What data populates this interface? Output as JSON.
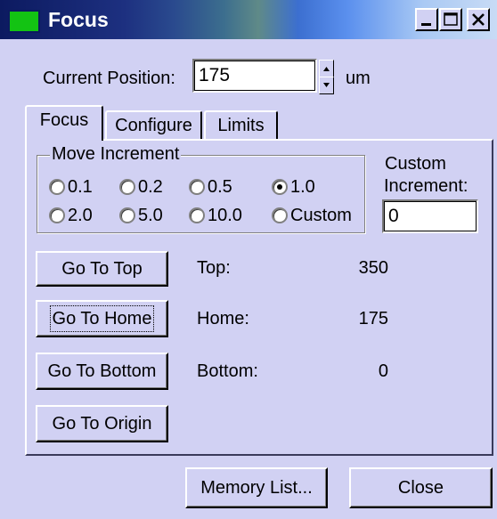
{
  "window": {
    "title": "Focus",
    "controls": {
      "minimize": "minimize-icon",
      "maximize": "maximize-icon",
      "close": "close-icon"
    }
  },
  "position": {
    "label": "Current Position:",
    "value": "175",
    "unit": "um"
  },
  "tabs": [
    {
      "label": "Focus",
      "selected": true
    },
    {
      "label": "Configure",
      "selected": false
    },
    {
      "label": "Limits",
      "selected": false
    }
  ],
  "move_increment": {
    "title": "Move Increment",
    "options": [
      {
        "label": "0.1",
        "selected": false
      },
      {
        "label": "0.2",
        "selected": false
      },
      {
        "label": "0.5",
        "selected": false
      },
      {
        "label": "1.0",
        "selected": true
      },
      {
        "label": "2.0",
        "selected": false
      },
      {
        "label": "5.0",
        "selected": false
      },
      {
        "label": "10.0",
        "selected": false
      },
      {
        "label": "Custom",
        "selected": false
      }
    ]
  },
  "custom_increment": {
    "label_line1": "Custom",
    "label_line2": "Increment:",
    "value": "0"
  },
  "goto": {
    "top_button": "Go To Top",
    "home_button": "Go To Home",
    "bottom_button": "Go To Bottom",
    "origin_button": "Go To Origin",
    "top_label": "Top:",
    "top_value": "350",
    "home_label": "Home:",
    "home_value": "175",
    "bottom_label": "Bottom:",
    "bottom_value": "0"
  },
  "footer": {
    "memory_button": "Memory List...",
    "close_button": "Close"
  },
  "colors": {
    "window_bg": "#d1d1f3",
    "title_bar_start": "#0c1a60",
    "title_bar_end": "#c8dbf5",
    "app_icon": "#13c313"
  }
}
